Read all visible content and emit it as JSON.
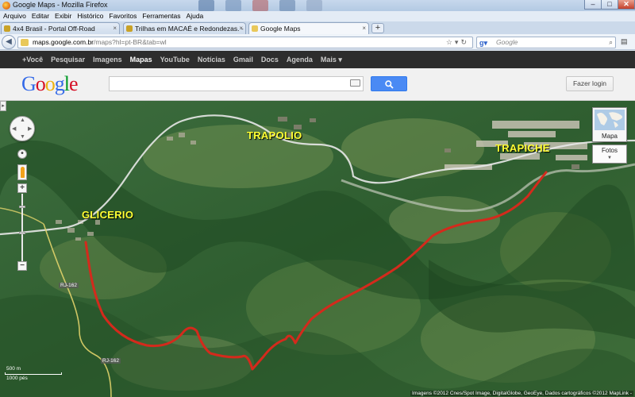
{
  "window": {
    "title": "Google Maps - Mozilla Firefox",
    "buttons": {
      "minimize": "–",
      "maximize": "□",
      "close": "✕"
    }
  },
  "menu": [
    "Arquivo",
    "Editar",
    "Exibir",
    "Histórico",
    "Favoritos",
    "Ferramentas",
    "Ajuda"
  ],
  "tabs": [
    {
      "label": "4x4 Brasil - Portal Off-Road",
      "icon": "tab-favicon",
      "color": "#c9a227"
    },
    {
      "label": "Trilhas em MACAÉ e Redondezas. - P...",
      "icon": "tab-favicon",
      "color": "#c9a227"
    },
    {
      "label": "Google Maps",
      "icon": "google-maps-favicon",
      "color": "#e9c85a",
      "active": true
    }
  ],
  "navbar": {
    "url_host": "maps.google.com.br",
    "url_path": "/maps?hl=pt-BR&tab=wl",
    "search_engine": "Google",
    "search_placeholder": "Google"
  },
  "gbar": [
    "+Você",
    "Pesquisar",
    "Imagens",
    "Mapas",
    "YouTube",
    "Notícias",
    "Gmail",
    "Docs",
    "Agenda",
    "Mais ▾"
  ],
  "gbar_active": "Mapas",
  "header": {
    "logo_letters": [
      {
        "ch": "G",
        "color": "#3369e8"
      },
      {
        "ch": "o",
        "color": "#d50f25"
      },
      {
        "ch": "o",
        "color": "#eeb211"
      },
      {
        "ch": "g",
        "color": "#3369e8"
      },
      {
        "ch": "l",
        "color": "#009925"
      },
      {
        "ch": "e",
        "color": "#d50f25"
      }
    ],
    "search_value": "",
    "login_label": "Fazer login"
  },
  "map": {
    "places": [
      "GLICERIO",
      "TRAPOLIO",
      "TRAPICHE"
    ],
    "map_type_label": "Mapa",
    "photos_label": "Fotos",
    "road_labels": [
      "RJ-162",
      "RJ-162"
    ],
    "scale_metric": "500 m",
    "scale_imperial": "1000 pés",
    "attribution": "Imagens ©2012 Cnes/Spot Image, DigitalGlobe, GeoEye, Dados cartográficos ©2012 MapLink -",
    "route_color": "#d42a1c",
    "label_color": "#ffff33"
  }
}
